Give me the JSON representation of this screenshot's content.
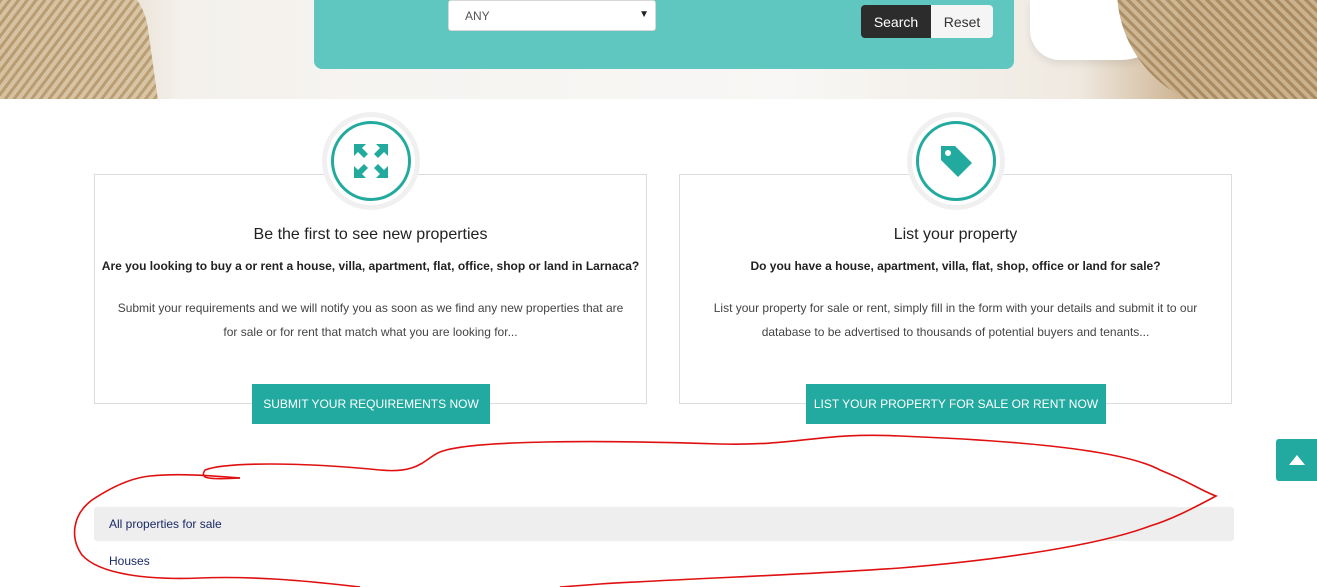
{
  "search": {
    "select_value": "ANY",
    "search_label": "Search",
    "reset_label": "Reset"
  },
  "cards": [
    {
      "icon": "expand-arrows-icon",
      "title": "Be the first to see new properties",
      "subtitle": "Are you looking to buy a or rent a house, villa, apartment, flat, office, shop or land in Larnaca?",
      "body": "Submit your requirements and we will notify you as soon as we find any new properties that are for sale or for rent that match what you are looking for...",
      "cta": "SUBMIT YOUR REQUIREMENTS NOW"
    },
    {
      "icon": "price-tag-icon",
      "title": "List your property",
      "subtitle": "Do you have a house, apartment, villa, flat, shop, office or land for sale?",
      "body": "List your property for sale or rent, simply fill in the form with your details and submit it to our database to be advertised to thousands of potential buyers and tenants...",
      "cta": "LIST YOUR PROPERTY FOR SALE OR RENT NOW"
    }
  ],
  "links": [
    {
      "label": "All properties for sale"
    },
    {
      "label": "Houses"
    }
  ],
  "scroll_top_icon": "chevron-up-icon",
  "colors": {
    "accent": "#22aaa0",
    "search_panel": "#5fc6c0",
    "annotation": "#e01010"
  }
}
